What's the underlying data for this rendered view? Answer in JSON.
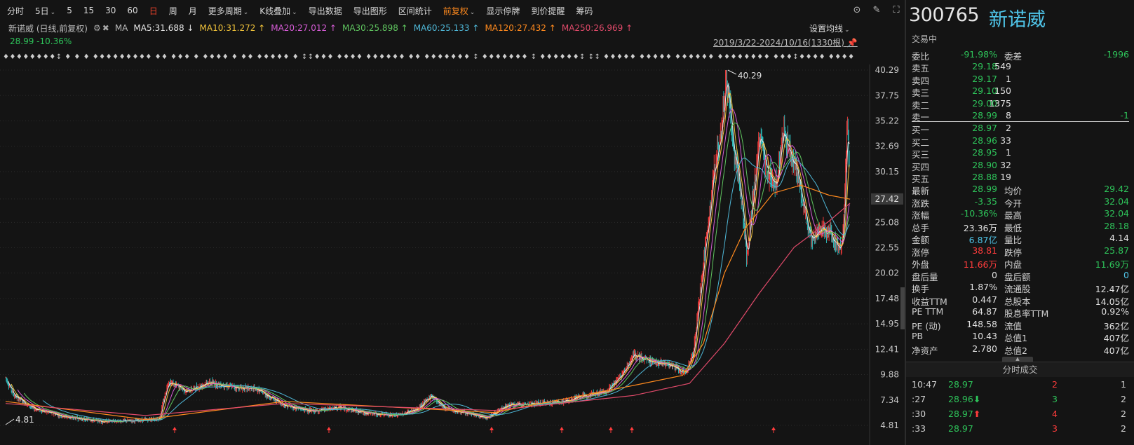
{
  "toolbar": {
    "items": [
      {
        "label": "分时",
        "caret": false,
        "state": "normal"
      },
      {
        "label": "5日",
        "caret": true,
        "state": "normal"
      },
      {
        "label": "5",
        "caret": false,
        "state": "normal"
      },
      {
        "label": "15",
        "caret": false,
        "state": "normal"
      },
      {
        "label": "30",
        "caret": false,
        "state": "normal"
      },
      {
        "label": "60",
        "caret": false,
        "state": "normal"
      },
      {
        "label": "日",
        "caret": false,
        "state": "red"
      },
      {
        "label": "周",
        "caret": false,
        "state": "normal"
      },
      {
        "label": "月",
        "caret": false,
        "state": "normal"
      },
      {
        "label": "更多周期",
        "caret": true,
        "state": "normal"
      },
      {
        "label": "K线叠加",
        "caret": true,
        "state": "normal"
      },
      {
        "label": "导出数据",
        "caret": false,
        "state": "normal"
      },
      {
        "label": "导出图形",
        "caret": false,
        "state": "normal"
      },
      {
        "label": "区间统计",
        "caret": false,
        "state": "normal"
      },
      {
        "label": "前复权",
        "caret": true,
        "state": "orange"
      },
      {
        "label": "显示停牌",
        "caret": false,
        "state": "normal"
      },
      {
        "label": "到价提醒",
        "caret": false,
        "state": "normal"
      },
      {
        "label": "筹码",
        "caret": false,
        "state": "normal"
      }
    ],
    "icons": [
      "collapse-circle-icon",
      "brush-icon",
      "fullscreen-icon"
    ]
  },
  "chart_header": {
    "title": "新诺威 (日线,前复权)",
    "ma_label": "MA",
    "ma": [
      {
        "text": "MA5:31.688 ↓",
        "color": "#e6e6e6"
      },
      {
        "text": "MA10:31.272 ↑",
        "color": "#f0c23a"
      },
      {
        "text": "MA20:27.012 ↑",
        "color": "#d65cd6"
      },
      {
        "text": "MA30:25.898 ↑",
        "color": "#5fc45f"
      },
      {
        "text": "MA60:25.133 ↑",
        "color": "#4fb8d8"
      },
      {
        "text": "MA120:27.432 ↑",
        "color": "#ff8a1e"
      },
      {
        "text": "MA250:26.969 ↑",
        "color": "#e04a6a"
      }
    ],
    "price_change": "28.99 -10.36%",
    "set_ma": "设置均线",
    "range": "2019/3/22-2024/10/16(1330根)",
    "marker_row": "♦♦♦♦♦♦♦♦↕ ♦  ♦  ♦      ♦♦♦♦♦♦♦♦♦  ♦♦ ♦♦♦ ♦ ♦♦♦♦    ♦     ♦♦ ♦♦♦♦♦ ♦    ↕↕♦♦♦   ♦♦♦♦ ♦♦♦♦♦♦   ♦♦  ♦♦♦♦♦♦♦   ↕ ♦♦♦♦♦♦♦   ↕   ♦♦♦♦♦♦↕ ↕↕ ♦♦♦♦♦ ♦♦♦♦♦ ♦♦♦♦♦♦ ♦♦♦♦♦♦♦♦   ♦♦♦↕♦♦♦♦ ♦♦♦♦♦♦♦♦♦♦♦♦♦♦♦♦ ♦♦♦  ♦ ♦♦♦"
  },
  "colors": {
    "up": "#ff3c3c",
    "down": "#2ec4c4",
    "ma5": "#e6e6e6",
    "ma10": "#f0c23a",
    "ma20": "#d65cd6",
    "ma30": "#5fc45f",
    "ma60": "#4fb8d8",
    "ma120": "#ff8a1e",
    "ma250": "#e04a6a"
  },
  "chart_data": {
    "type": "candlestick",
    "y_ticks": [
      "40.29",
      "37.75",
      "35.22",
      "32.69",
      "30.15",
      "27.42",
      "25.08",
      "22.55",
      "20.02",
      "17.48",
      "14.95",
      "12.41",
      "9.88",
      "7.34",
      "4.81"
    ],
    "ylim": [
      4.81,
      40.29
    ],
    "current_price_tag": "27.42",
    "high_label": "40.29",
    "low_label": "4.81",
    "bars": 1330,
    "price_path": [
      [
        0,
        9.6
      ],
      [
        12,
        7.8
      ],
      [
        40,
        6.5
      ],
      [
        90,
        5.6
      ],
      [
        140,
        5.2
      ],
      [
        190,
        5.3
      ],
      [
        220,
        5.5
      ],
      [
        233,
        9.2
      ],
      [
        260,
        8.2
      ],
      [
        290,
        9.1
      ],
      [
        330,
        8.6
      ],
      [
        360,
        8.4
      ],
      [
        400,
        6.8
      ],
      [
        440,
        6.2
      ],
      [
        480,
        6.6
      ],
      [
        520,
        6.0
      ],
      [
        560,
        5.8
      ],
      [
        590,
        6.4
      ],
      [
        610,
        7.8
      ],
      [
        630,
        6.5
      ],
      [
        660,
        6.0
      ],
      [
        690,
        5.6
      ],
      [
        720,
        6.8
      ],
      [
        760,
        7.0
      ],
      [
        800,
        7.2
      ],
      [
        830,
        7.8
      ],
      [
        860,
        8.2
      ],
      [
        880,
        9.6
      ],
      [
        900,
        11.8
      ],
      [
        920,
        11.3
      ],
      [
        940,
        11.0
      ],
      [
        960,
        10.6
      ],
      [
        975,
        10.0
      ],
      [
        985,
        12.0
      ],
      [
        995,
        18.0
      ],
      [
        1005,
        24.0
      ],
      [
        1015,
        30.0
      ],
      [
        1025,
        34.0
      ],
      [
        1033,
        40.0
      ],
      [
        1042,
        33.0
      ],
      [
        1050,
        30.0
      ],
      [
        1058,
        25.0
      ],
      [
        1062,
        21.5
      ],
      [
        1070,
        27.0
      ],
      [
        1080,
        33.5
      ],
      [
        1092,
        30.0
      ],
      [
        1105,
        29.0
      ],
      [
        1115,
        34.5
      ],
      [
        1125,
        31.5
      ],
      [
        1135,
        30.0
      ],
      [
        1145,
        26.0
      ],
      [
        1155,
        23.5
      ],
      [
        1170,
        24.5
      ],
      [
        1185,
        23.8
      ],
      [
        1195,
        22.5
      ],
      [
        1200,
        24.0
      ],
      [
        1206,
        34.5
      ],
      [
        1210,
        29.0
      ]
    ],
    "ma_paths": {
      "ma120": [
        [
          0,
          7.2
        ],
        [
          200,
          5.4
        ],
        [
          400,
          7.2
        ],
        [
          700,
          6.1
        ],
        [
          900,
          8.8
        ],
        [
          970,
          9.8
        ],
        [
          1000,
          13.0
        ],
        [
          1030,
          20.0
        ],
        [
          1060,
          24.5
        ],
        [
          1100,
          28.0
        ],
        [
          1140,
          28.8
        ],
        [
          1180,
          27.8
        ],
        [
          1210,
          27.4
        ]
      ],
      "ma250": [
        [
          0,
          7.0
        ],
        [
          200,
          5.8
        ],
        [
          400,
          7.0
        ],
        [
          700,
          6.3
        ],
        [
          900,
          7.8
        ],
        [
          980,
          9.0
        ],
        [
          1030,
          13.0
        ],
        [
          1080,
          18.0
        ],
        [
          1130,
          22.6
        ],
        [
          1180,
          25.2
        ],
        [
          1210,
          27.0
        ]
      ]
    },
    "bottom_markers": [
      249,
      469,
      701,
      801,
      871,
      901,
      1103
    ]
  },
  "quote": {
    "code": "300765",
    "name": "新诺威",
    "status": "交易中",
    "weibi": {
      "label": "委比",
      "value": "-91.98%",
      "label2": "委差",
      "value2": "-1996"
    },
    "asks": [
      {
        "label": "卖五",
        "price": "29.18",
        "vol": "549",
        "chg": ""
      },
      {
        "label": "卖四",
        "price": "29.17",
        "vol": "1",
        "chg": ""
      },
      {
        "label": "卖三",
        "price": "29.10",
        "vol": "150",
        "chg": ""
      },
      {
        "label": "卖二",
        "price": "29.00",
        "vol": "1375",
        "chg": ""
      },
      {
        "label": "卖一",
        "price": "28.99",
        "vol": "8",
        "chg": "-1"
      }
    ],
    "bids": [
      {
        "label": "买一",
        "price": "28.97",
        "vol": "2"
      },
      {
        "label": "买二",
        "price": "28.96",
        "vol": "33"
      },
      {
        "label": "买三",
        "price": "28.95",
        "vol": "1"
      },
      {
        "label": "买四",
        "price": "28.90",
        "vol": "32"
      },
      {
        "label": "买五",
        "price": "28.88",
        "vol": "19"
      }
    ],
    "stats": [
      {
        "l1": "最新",
        "v1": "28.99",
        "c1": "g",
        "l2": "均价",
        "v2": "29.42",
        "c2": "g"
      },
      {
        "l1": "涨跌",
        "v1": "-3.35",
        "c1": "g",
        "l2": "今开",
        "v2": "32.04",
        "c2": "g"
      },
      {
        "l1": "涨幅",
        "v1": "-10.36%",
        "c1": "g",
        "l2": "最高",
        "v2": "32.04",
        "c2": "g"
      },
      {
        "l1": "总手",
        "v1": "23.36万",
        "c1": "w",
        "l2": "最低",
        "v2": "28.18",
        "c2": "g"
      },
      {
        "l1": "金额",
        "v1": "6.87亿",
        "c1": "b",
        "l2": "量比",
        "v2": "4.14",
        "c2": "w"
      },
      {
        "l1": "涨停",
        "v1": "38.81",
        "c1": "r",
        "l2": "跌停",
        "v2": "25.87",
        "c2": "g"
      },
      {
        "l1": "外盘",
        "v1": "11.66万",
        "c1": "r",
        "l2": "内盘",
        "v2": "11.69万",
        "c2": "g"
      },
      {
        "l1": "盘后量",
        "v1": "0",
        "c1": "w",
        "l2": "盘后额",
        "v2": "0",
        "c2": "b"
      },
      {
        "l1": "换手",
        "v1": "1.87%",
        "c1": "w",
        "l2": "流通股",
        "v2": "12.47亿",
        "c2": "w"
      },
      {
        "l1": "收益TTM",
        "v1": "0.447",
        "c1": "w",
        "l2": "总股本",
        "v2": "14.05亿",
        "c2": "w"
      },
      {
        "l1": "PE TTM",
        "v1": "64.87",
        "c1": "w",
        "l2": "股息率TTM",
        "v2": "0.92%",
        "c2": "w"
      },
      {
        "l1": "PE (动)",
        "v1": "148.58",
        "c1": "w",
        "l2": "流值",
        "v2": "362亿",
        "c2": "w"
      },
      {
        "l1": "PB",
        "v1": "10.43",
        "c1": "w",
        "l2": "总值1",
        "v2": "407亿",
        "c2": "w"
      },
      {
        "l1": "净资产",
        "v1": "2.780",
        "c1": "w",
        "l2": "总值2",
        "v2": "407亿",
        "c2": "w"
      }
    ],
    "collapse_glyph": "▲",
    "trades_title": "分时成交",
    "trades": [
      {
        "time": "10:47",
        "price": "28.97",
        "pc": "g",
        "arrow": "",
        "vol": "2",
        "vc": "r",
        "num": "1"
      },
      {
        "time": ":27",
        "price": "28.96",
        "pc": "g",
        "arrow": "⬇",
        "ac": "g",
        "vol": "3",
        "vc": "g",
        "num": "2"
      },
      {
        "time": ":30",
        "price": "28.97",
        "pc": "g",
        "arrow": "⬆",
        "ac": "r",
        "vol": "4",
        "vc": "r",
        "num": "2"
      },
      {
        "time": ":33",
        "price": "28.97",
        "pc": "g",
        "arrow": "",
        "vol": "3",
        "vc": "r",
        "num": "2"
      }
    ]
  }
}
